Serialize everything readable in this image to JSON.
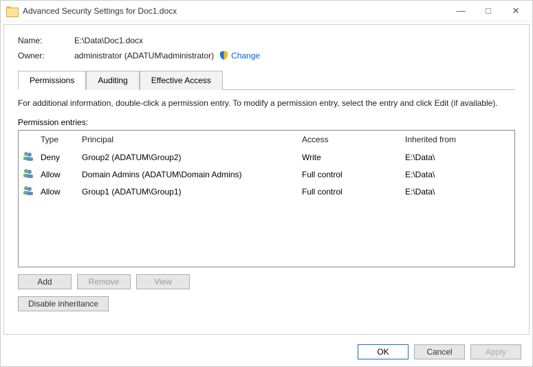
{
  "window": {
    "title": "Advanced Security Settings for Doc1.docx"
  },
  "info": {
    "name_label": "Name:",
    "name_value": "E:\\Data\\Doc1.docx",
    "owner_label": "Owner:",
    "owner_value": "administrator (ADATUM\\administrator)",
    "change_label": "Change"
  },
  "tabs": {
    "permissions": "Permissions",
    "auditing": "Auditing",
    "effective": "Effective Access"
  },
  "instructions": "For additional information, double-click a permission entry. To modify a permission entry, select the entry and click Edit (if available).",
  "entries_label": "Permission entries:",
  "columns": {
    "type": "Type",
    "principal": "Principal",
    "access": "Access",
    "inherited": "Inherited from"
  },
  "entries": [
    {
      "type": "Deny",
      "principal": "Group2 (ADATUM\\Group2)",
      "access": "Write",
      "inherited": "E:\\Data\\"
    },
    {
      "type": "Allow",
      "principal": "Domain Admins (ADATUM\\Domain Admins)",
      "access": "Full control",
      "inherited": "E:\\Data\\"
    },
    {
      "type": "Allow",
      "principal": "Group1 (ADATUM\\Group1)",
      "access": "Full control",
      "inherited": "E:\\Data\\"
    }
  ],
  "buttons": {
    "add": "Add",
    "remove": "Remove",
    "view": "View",
    "disable_inheritance": "Disable inheritance",
    "ok": "OK",
    "cancel": "Cancel",
    "apply": "Apply"
  }
}
